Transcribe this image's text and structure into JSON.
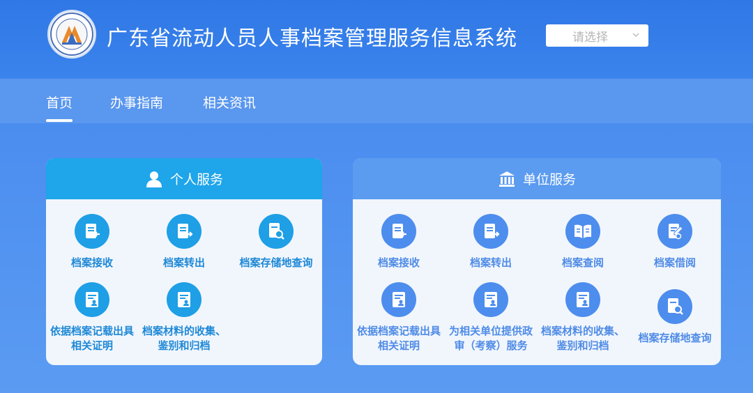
{
  "header": {
    "site_title": "广东省流动人员人事档案管理服务信息系统",
    "select_placeholder": "请选择"
  },
  "nav": {
    "items": [
      {
        "label": "首页",
        "active": true
      },
      {
        "label": "办事指南",
        "active": false
      },
      {
        "label": "相关资讯",
        "active": false
      }
    ]
  },
  "personal": {
    "title": "个人服务",
    "header_color": "#1ea5ea",
    "items": [
      {
        "label": "档案接收",
        "icon": "file-receive-icon"
      },
      {
        "label": "档案转出",
        "icon": "file-transfer-out-icon"
      },
      {
        "label": "档案存储地查询",
        "icon": "file-search-icon"
      },
      {
        "label_line1": "依据档案记载出具",
        "label_line2": "相关证明",
        "icon": "certificate-icon"
      },
      {
        "label_line1": "档案材料的收集、",
        "label_line2": "鉴别和归档",
        "icon": "archive-material-icon"
      }
    ]
  },
  "unit": {
    "title": "单位服务",
    "header_color": "#5b9bf0",
    "items": [
      {
        "label": "档案接收",
        "icon": "file-receive-icon"
      },
      {
        "label": "档案转出",
        "icon": "file-transfer-out-icon"
      },
      {
        "label": "档案查阅",
        "icon": "book-open-icon"
      },
      {
        "label": "档案借阅",
        "icon": "file-borrow-icon"
      },
      {
        "label_line1": "依据档案记载出具",
        "label_line2": "相关证明",
        "icon": "certificate-icon"
      },
      {
        "label_line1": "为相关单位提供政",
        "label_line2": "审（考察）服务",
        "icon": "political-review-icon"
      },
      {
        "label_line1": "档案材料的收集、",
        "label_line2": "鉴别和归档",
        "icon": "archive-material-icon"
      },
      {
        "label": "档案存储地查询",
        "icon": "file-search-icon"
      }
    ]
  }
}
